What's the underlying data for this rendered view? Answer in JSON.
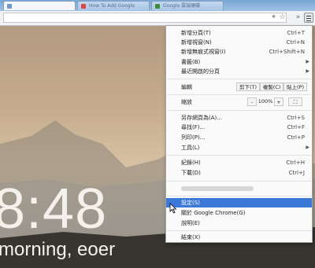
{
  "tabs": [
    {
      "title": "",
      "favicon": "blank-page-icon"
    },
    {
      "title": "How To Add Google",
      "favicon": "youtube-icon"
    },
    {
      "title": "Google 雲端硬碟",
      "favicon": "google-drive-icon"
    }
  ],
  "toolbar": {
    "icons": [
      "target-icon",
      "star-icon",
      "extensions-chevron-icon",
      "hamburger-menu-icon"
    ],
    "extensions_chevron": "»"
  },
  "new_tab": {
    "clock": "8:48",
    "greeting": "morning, eoer"
  },
  "menu": {
    "new_tab": {
      "label": "新增分頁(T)",
      "shortcut": "Ctrl+T"
    },
    "new_window": {
      "label": "新增視窗(N)",
      "shortcut": "Ctrl+N"
    },
    "incognito": {
      "label": "新增無痕式視窗(I)",
      "shortcut": "Ctrl+Shift+N"
    },
    "bookmarks": {
      "label": "書籤(B)"
    },
    "recent_tabs": {
      "label": "最近開啟的分頁"
    },
    "edit": {
      "label": "編輯",
      "cut": "剪下(T)",
      "copy": "複製(C)",
      "paste": "貼上(P)"
    },
    "zoom": {
      "label": "縮放",
      "minus": "-",
      "value": "100%",
      "plus": "+",
      "fullscreen_icon": "fullscreen-icon"
    },
    "save_page": {
      "label": "另存網頁為(A)...",
      "shortcut": "Ctrl+S"
    },
    "find": {
      "label": "尋找(F)...",
      "shortcut": "Ctrl+F"
    },
    "print": {
      "label": "列印(P)...",
      "shortcut": "Ctrl+P"
    },
    "tools": {
      "label": "工具(L)"
    },
    "history": {
      "label": "紀錄(H)",
      "shortcut": "Ctrl+H"
    },
    "downloads": {
      "label": "下載(D)",
      "shortcut": "Ctrl+J"
    },
    "settings": {
      "label": "設定(S)"
    },
    "about": {
      "label": "關於 Google Chrome(G)"
    },
    "help": {
      "label": "說明(E)"
    },
    "exit": {
      "label": "結束(X)"
    },
    "highlight_color": "#3c78d8"
  }
}
